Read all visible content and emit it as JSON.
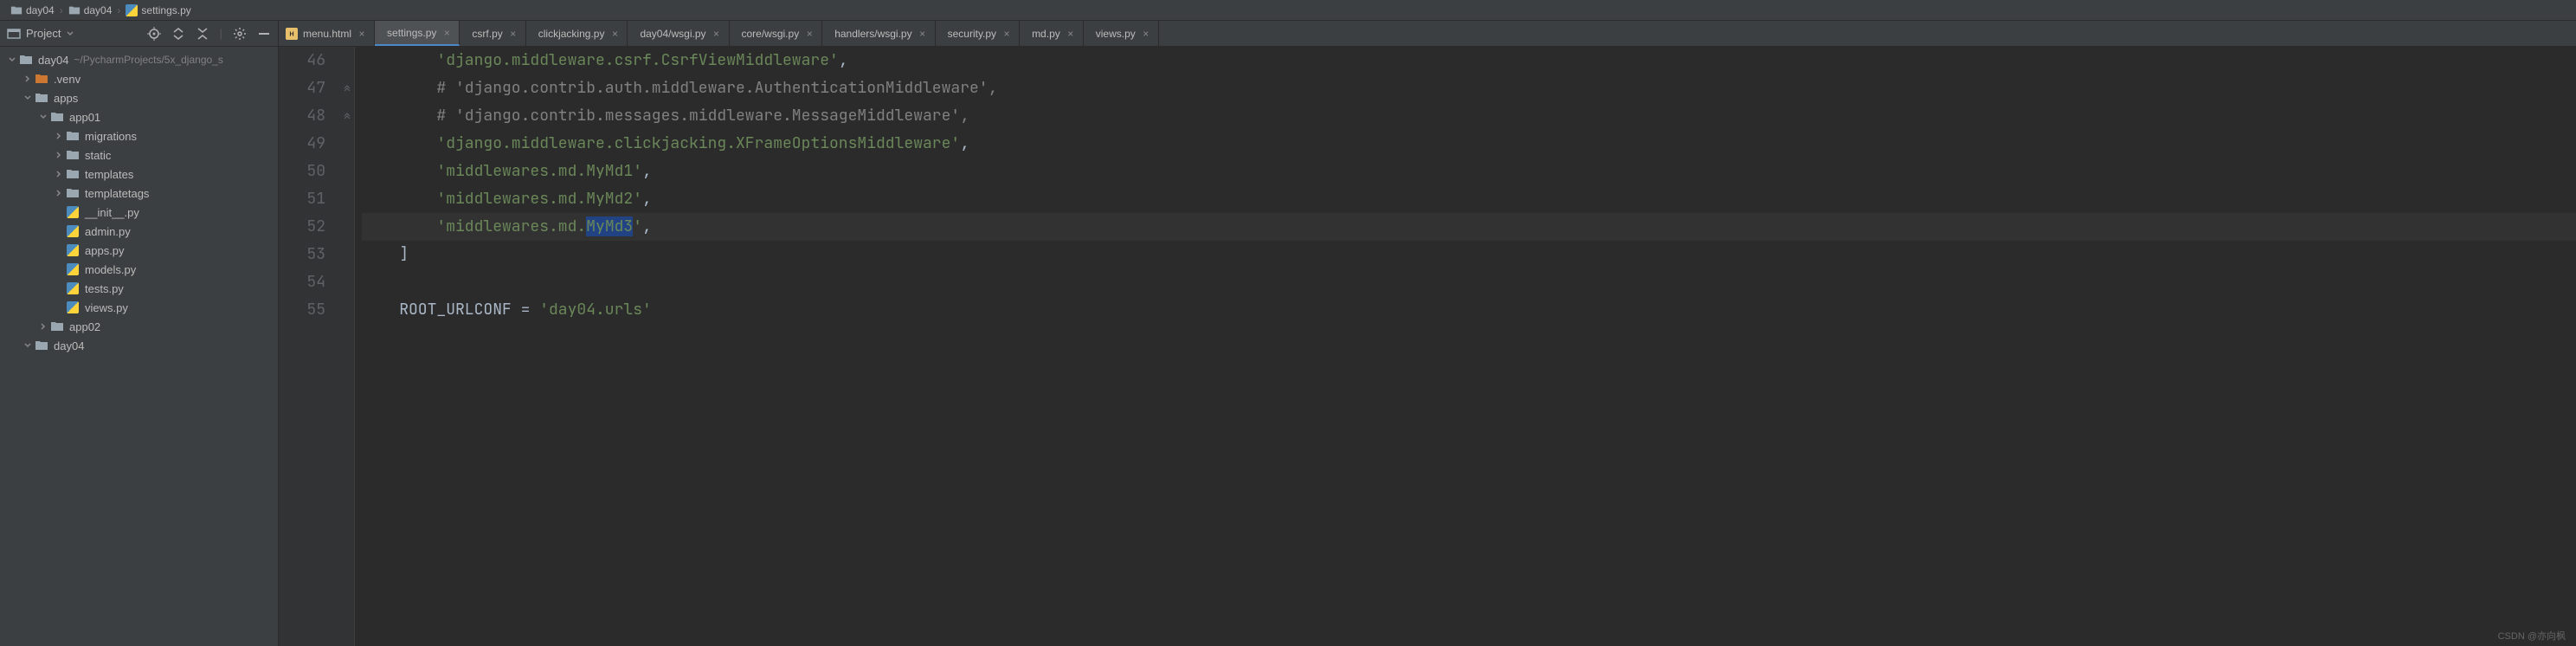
{
  "breadcrumb": {
    "items": [
      {
        "label": "day04",
        "icon": "folder"
      },
      {
        "label": "day04",
        "icon": "folder"
      },
      {
        "label": "settings.py",
        "icon": "python"
      }
    ]
  },
  "sidebar": {
    "title": "Project",
    "tree": [
      {
        "depth": 0,
        "expanded": true,
        "icon": "project-folder",
        "label": "day04",
        "hint": "~/PycharmProjects/5x_django_s"
      },
      {
        "depth": 1,
        "expanded": false,
        "icon": "excluded-folder",
        "label": ".venv"
      },
      {
        "depth": 1,
        "expanded": true,
        "icon": "folder",
        "label": "apps"
      },
      {
        "depth": 2,
        "expanded": true,
        "icon": "folder",
        "label": "app01"
      },
      {
        "depth": 3,
        "expanded": false,
        "icon": "folder",
        "label": "migrations"
      },
      {
        "depth": 3,
        "expanded": false,
        "icon": "folder",
        "label": "static"
      },
      {
        "depth": 3,
        "expanded": false,
        "icon": "folder",
        "label": "templates"
      },
      {
        "depth": 3,
        "expanded": false,
        "icon": "folder",
        "label": "templatetags"
      },
      {
        "depth": 3,
        "expanded": null,
        "icon": "python",
        "label": "__init__.py"
      },
      {
        "depth": 3,
        "expanded": null,
        "icon": "python",
        "label": "admin.py"
      },
      {
        "depth": 3,
        "expanded": null,
        "icon": "python",
        "label": "apps.py"
      },
      {
        "depth": 3,
        "expanded": null,
        "icon": "python",
        "label": "models.py"
      },
      {
        "depth": 3,
        "expanded": null,
        "icon": "python",
        "label": "tests.py"
      },
      {
        "depth": 3,
        "expanded": null,
        "icon": "python",
        "label": "views.py"
      },
      {
        "depth": 2,
        "expanded": false,
        "icon": "folder",
        "label": "app02"
      },
      {
        "depth": 1,
        "expanded": true,
        "icon": "folder",
        "label": "day04"
      }
    ]
  },
  "tabs": [
    {
      "label": "menu.html",
      "icon": "html",
      "active": false
    },
    {
      "label": "settings.py",
      "icon": "python",
      "active": true
    },
    {
      "label": "csrf.py",
      "icon": "python",
      "active": false
    },
    {
      "label": "clickjacking.py",
      "icon": "python",
      "active": false
    },
    {
      "label": "day04/wsgi.py",
      "icon": "python",
      "active": false
    },
    {
      "label": "core/wsgi.py",
      "icon": "python",
      "active": false
    },
    {
      "label": "handlers/wsgi.py",
      "icon": "python",
      "active": false
    },
    {
      "label": "security.py",
      "icon": "python",
      "active": false
    },
    {
      "label": "md.py",
      "icon": "python",
      "active": false
    },
    {
      "label": "views.py",
      "icon": "python",
      "active": false
    }
  ],
  "editor": {
    "startLine": 46,
    "currentLine": 52,
    "lines": [
      {
        "num": 46,
        "indent": "        ",
        "segments": [
          {
            "t": "str",
            "v": "'django.middleware.csrf.CsrfViewMiddleware'"
          },
          {
            "t": "plain",
            "v": ","
          }
        ]
      },
      {
        "num": 47,
        "indent": "        ",
        "segments": [
          {
            "t": "comment",
            "v": "# 'django.contrib.auth.middleware.AuthenticationMiddleware',"
          }
        ]
      },
      {
        "num": 48,
        "indent": "        ",
        "segments": [
          {
            "t": "comment",
            "v": "# 'django.contrib.messages.middleware.MessageMiddleware',"
          }
        ]
      },
      {
        "num": 49,
        "indent": "        ",
        "segments": [
          {
            "t": "str",
            "v": "'django.middleware.clickjacking.XFrameOptionsMiddleware'"
          },
          {
            "t": "plain",
            "v": ","
          }
        ]
      },
      {
        "num": 50,
        "indent": "        ",
        "segments": [
          {
            "t": "str",
            "v": "'middlewares.md.MyMd1'"
          },
          {
            "t": "plain",
            "v": ","
          }
        ]
      },
      {
        "num": 51,
        "indent": "        ",
        "segments": [
          {
            "t": "str",
            "v": "'middlewares.md.MyMd2'"
          },
          {
            "t": "plain",
            "v": ","
          }
        ]
      },
      {
        "num": 52,
        "indent": "        ",
        "segments": [
          {
            "t": "str",
            "v": "'middlewares.md."
          },
          {
            "t": "caret-hl",
            "v": "MyMd3"
          },
          {
            "t": "str",
            "v": "'"
          },
          {
            "t": "plain",
            "v": ","
          }
        ],
        "current": true,
        "caretCol": 21
      },
      {
        "num": 53,
        "indent": "    ",
        "segments": [
          {
            "t": "plain",
            "v": "]"
          }
        ]
      },
      {
        "num": 54,
        "indent": "",
        "segments": []
      },
      {
        "num": 55,
        "indent": "    ",
        "segments": [
          {
            "t": "ident",
            "v": "ROOT_URLCONF = "
          },
          {
            "t": "str",
            "v": "'day04.urls'"
          }
        ]
      }
    ]
  },
  "watermark": "CSDN @亦向枫"
}
